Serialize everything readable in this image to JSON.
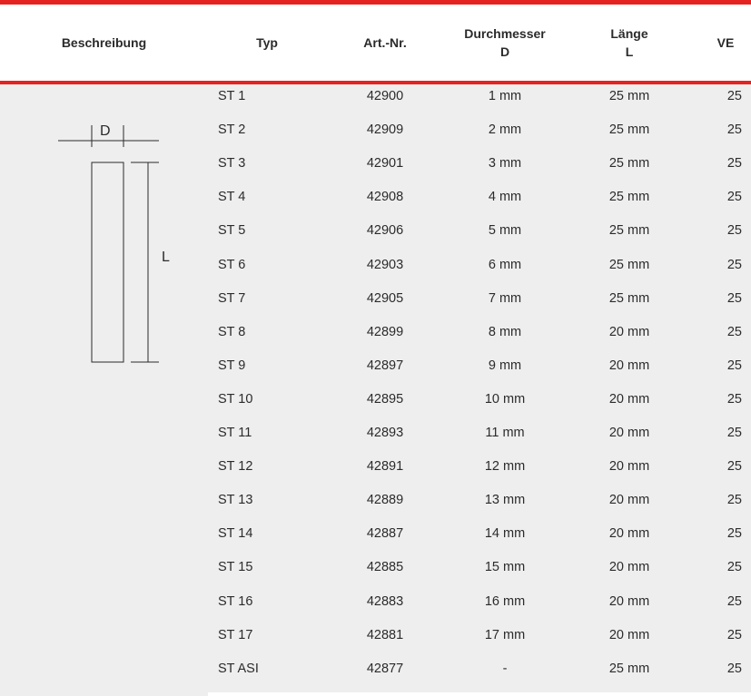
{
  "header": {
    "beschreibung": "Beschreibung",
    "typ": "Typ",
    "art_nr": "Art.-Nr.",
    "durchmesser": "Durchmesser",
    "durchmesser_sym": "D",
    "laenge": "Länge",
    "laenge_sym": "L",
    "ve": "VE"
  },
  "drawing": {
    "d_label": "D",
    "l_label": "L"
  },
  "colors": {
    "accent": "#e52320",
    "row_bg": "#eeeeee",
    "text": "#2b2b2b"
  },
  "rows": [
    {
      "typ": "ST 1",
      "art": "42900",
      "d": "1 mm",
      "l": "25 mm",
      "ve": "25"
    },
    {
      "typ": "ST 2",
      "art": "42909",
      "d": "2 mm",
      "l": "25 mm",
      "ve": "25"
    },
    {
      "typ": "ST 3",
      "art": "42901",
      "d": "3 mm",
      "l": "25 mm",
      "ve": "25"
    },
    {
      "typ": "ST 4",
      "art": "42908",
      "d": "4 mm",
      "l": "25 mm",
      "ve": "25"
    },
    {
      "typ": "ST 5",
      "art": "42906",
      "d": "5 mm",
      "l": "25 mm",
      "ve": "25"
    },
    {
      "typ": "ST 6",
      "art": "42903",
      "d": "6 mm",
      "l": "25 mm",
      "ve": "25"
    },
    {
      "typ": "ST 7",
      "art": "42905",
      "d": "7 mm",
      "l": "25 mm",
      "ve": "25"
    },
    {
      "typ": "ST 8",
      "art": "42899",
      "d": "8 mm",
      "l": "20 mm",
      "ve": "25"
    },
    {
      "typ": "ST 9",
      "art": "42897",
      "d": "9 mm",
      "l": "20 mm",
      "ve": "25"
    },
    {
      "typ": "ST 10",
      "art": "42895",
      "d": "10 mm",
      "l": "20 mm",
      "ve": "25"
    },
    {
      "typ": "ST 11",
      "art": "42893",
      "d": "11 mm",
      "l": "20 mm",
      "ve": "25"
    },
    {
      "typ": "ST 12",
      "art": "42891",
      "d": "12 mm",
      "l": "20 mm",
      "ve": "25"
    },
    {
      "typ": "ST 13",
      "art": "42889",
      "d": "13 mm",
      "l": "20 mm",
      "ve": "25"
    },
    {
      "typ": "ST 14",
      "art": "42887",
      "d": "14 mm",
      "l": "20 mm",
      "ve": "25"
    },
    {
      "typ": "ST 15",
      "art": "42885",
      "d": "15 mm",
      "l": "20 mm",
      "ve": "25"
    },
    {
      "typ": "ST 16",
      "art": "42883",
      "d": "16 mm",
      "l": "20 mm",
      "ve": "25"
    },
    {
      "typ": "ST 17",
      "art": "42881",
      "d": "17 mm",
      "l": "20 mm",
      "ve": "25"
    },
    {
      "typ": "ST ASI",
      "art": "42877",
      "d": "-",
      "l": "25 mm",
      "ve": "25"
    }
  ]
}
